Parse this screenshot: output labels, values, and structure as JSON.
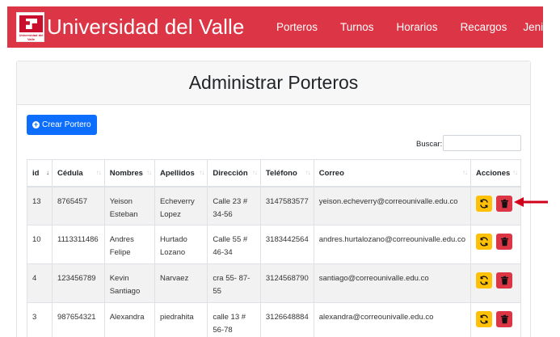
{
  "navbar": {
    "logo_text": "Universidad del Valle",
    "title": "Universidad del Valle",
    "links": [
      "Porteros",
      "Turnos",
      "Horarios",
      "Recargos"
    ],
    "user": "Jenifer",
    "bg_color": "#dc3545"
  },
  "page": {
    "title": "Administrar Porteros",
    "create_button": "Crear Portero",
    "search_label": "Buscar:",
    "search_value": ""
  },
  "table": {
    "headers": [
      "id",
      "Cédula",
      "Nombres",
      "Apellidos",
      "Dirección",
      "Teléfono",
      "Correo",
      "Acciones"
    ],
    "rows": [
      {
        "id": "13",
        "cedula": "8765457",
        "nombres": "Yeison Esteban",
        "apellidos": "Echeverry Lopez",
        "direccion": "Calle 23 # 34-56",
        "telefono": "3147583577",
        "correo": "yeison.echeverry@correounivalle.edu.co"
      },
      {
        "id": "10",
        "cedula": "1113311486",
        "nombres": "Andres Felipe",
        "apellidos": "Hurtado Lozano",
        "direccion": "Calle 55 # 46-34",
        "telefono": "3183442564",
        "correo": "andres.hurtalozano@correounivalle.edu.co"
      },
      {
        "id": "4",
        "cedula": "123456789",
        "nombres": "Kevin Santiago",
        "apellidos": "Narvaez",
        "direccion": "cra 55- 87-55",
        "telefono": "3124568790",
        "correo": "santiago@correounivalle.edu.co"
      },
      {
        "id": "3",
        "cedula": "987654321",
        "nombres": "Alexandra",
        "apellidos": "piedrahita",
        "direccion": "calle 13 # 56-78",
        "telefono": "3126648884",
        "correo": "alexandra@correounivalle.edu.co"
      }
    ]
  },
  "icons": {
    "refresh": "refresh-icon",
    "delete": "trash-icon",
    "annotation": "arrow-left-icon"
  },
  "colors": {
    "primary": "#0d6efd",
    "warning": "#ffc107",
    "danger": "#dc3545"
  }
}
